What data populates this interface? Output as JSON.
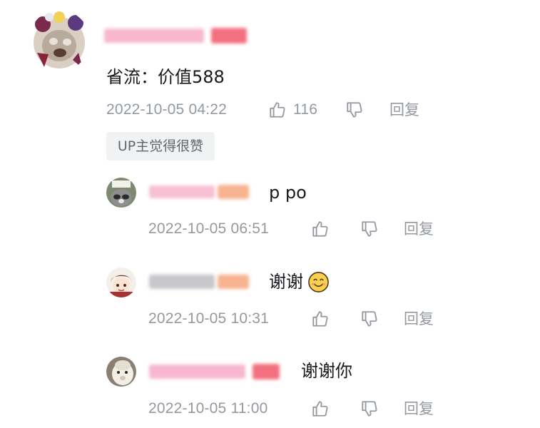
{
  "main_comment": {
    "text": "省流：价值588",
    "time": "2022-10-05 04:22",
    "like_count": "116",
    "reply_label": "回复",
    "badge": "UP主觉得很赞"
  },
  "replies": [
    {
      "text": "p po",
      "time": "2022-10-05 06:51",
      "reply_label": "回复"
    },
    {
      "text": "谢谢",
      "emoji": "smile-emoji",
      "time": "2022-10-05 10:31",
      "reply_label": "回复"
    },
    {
      "text": "谢谢你",
      "time": "2022-10-05 11:00",
      "reply_label": "回复"
    }
  ],
  "colors": {
    "text": "#18191c",
    "meta": "#9499a0",
    "badge_bg": "#f1f2f3",
    "blur_pink": "#f7a8c4",
    "blur_orange": "#f7b38f"
  },
  "icons": [
    "thumbs-up-icon",
    "thumbs-down-icon"
  ]
}
